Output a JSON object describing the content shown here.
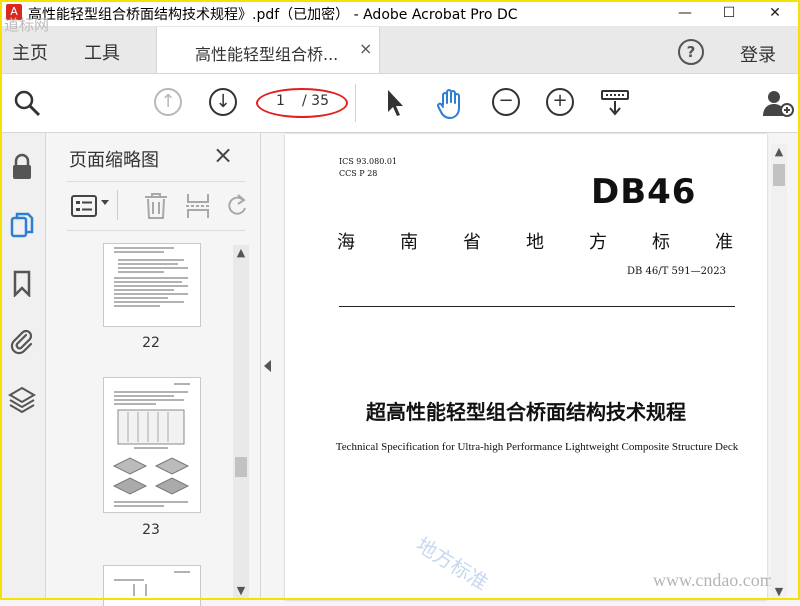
{
  "window": {
    "title": "高性能轻型组合桥面结构技术规程》.pdf（已加密） - Adobe Acrobat Pro DC",
    "minimize_glyph": "—",
    "maximize_glyph": "☐",
    "close_glyph": "✕"
  },
  "tabs": {
    "home": "主页",
    "tools": "工具",
    "document": "高性能轻型组合桥...",
    "document_close": "×",
    "help": "?",
    "login": "登录"
  },
  "toolbar": {
    "current_page": "1",
    "total_pages": "/ 35"
  },
  "thumbnails": {
    "title": "页面缩略图",
    "close": "×",
    "pages": [
      "22",
      "23"
    ]
  },
  "document": {
    "ics": "ICS  93.080.01",
    "ccs": "CCS  P 28",
    "db_mark": "DB46",
    "province_chars": [
      "海",
      "南",
      "省",
      "地",
      "方",
      "标",
      "准"
    ],
    "standard_number": "DB 46/T  591—2023",
    "title_cn": "超高性能轻型组合桥面结构技术规程",
    "title_en": "Technical Specification for Ultra-high Performance Lightweight Composite Structure Deck"
  },
  "watermarks": {
    "top_left": "道标网",
    "diagonal": "地方标准",
    "url": "www.cndao.com"
  },
  "colors": {
    "highlight_oval": "#e0201c",
    "hand_tool_active": "#2d7fd6",
    "frame": "#f4e300"
  }
}
